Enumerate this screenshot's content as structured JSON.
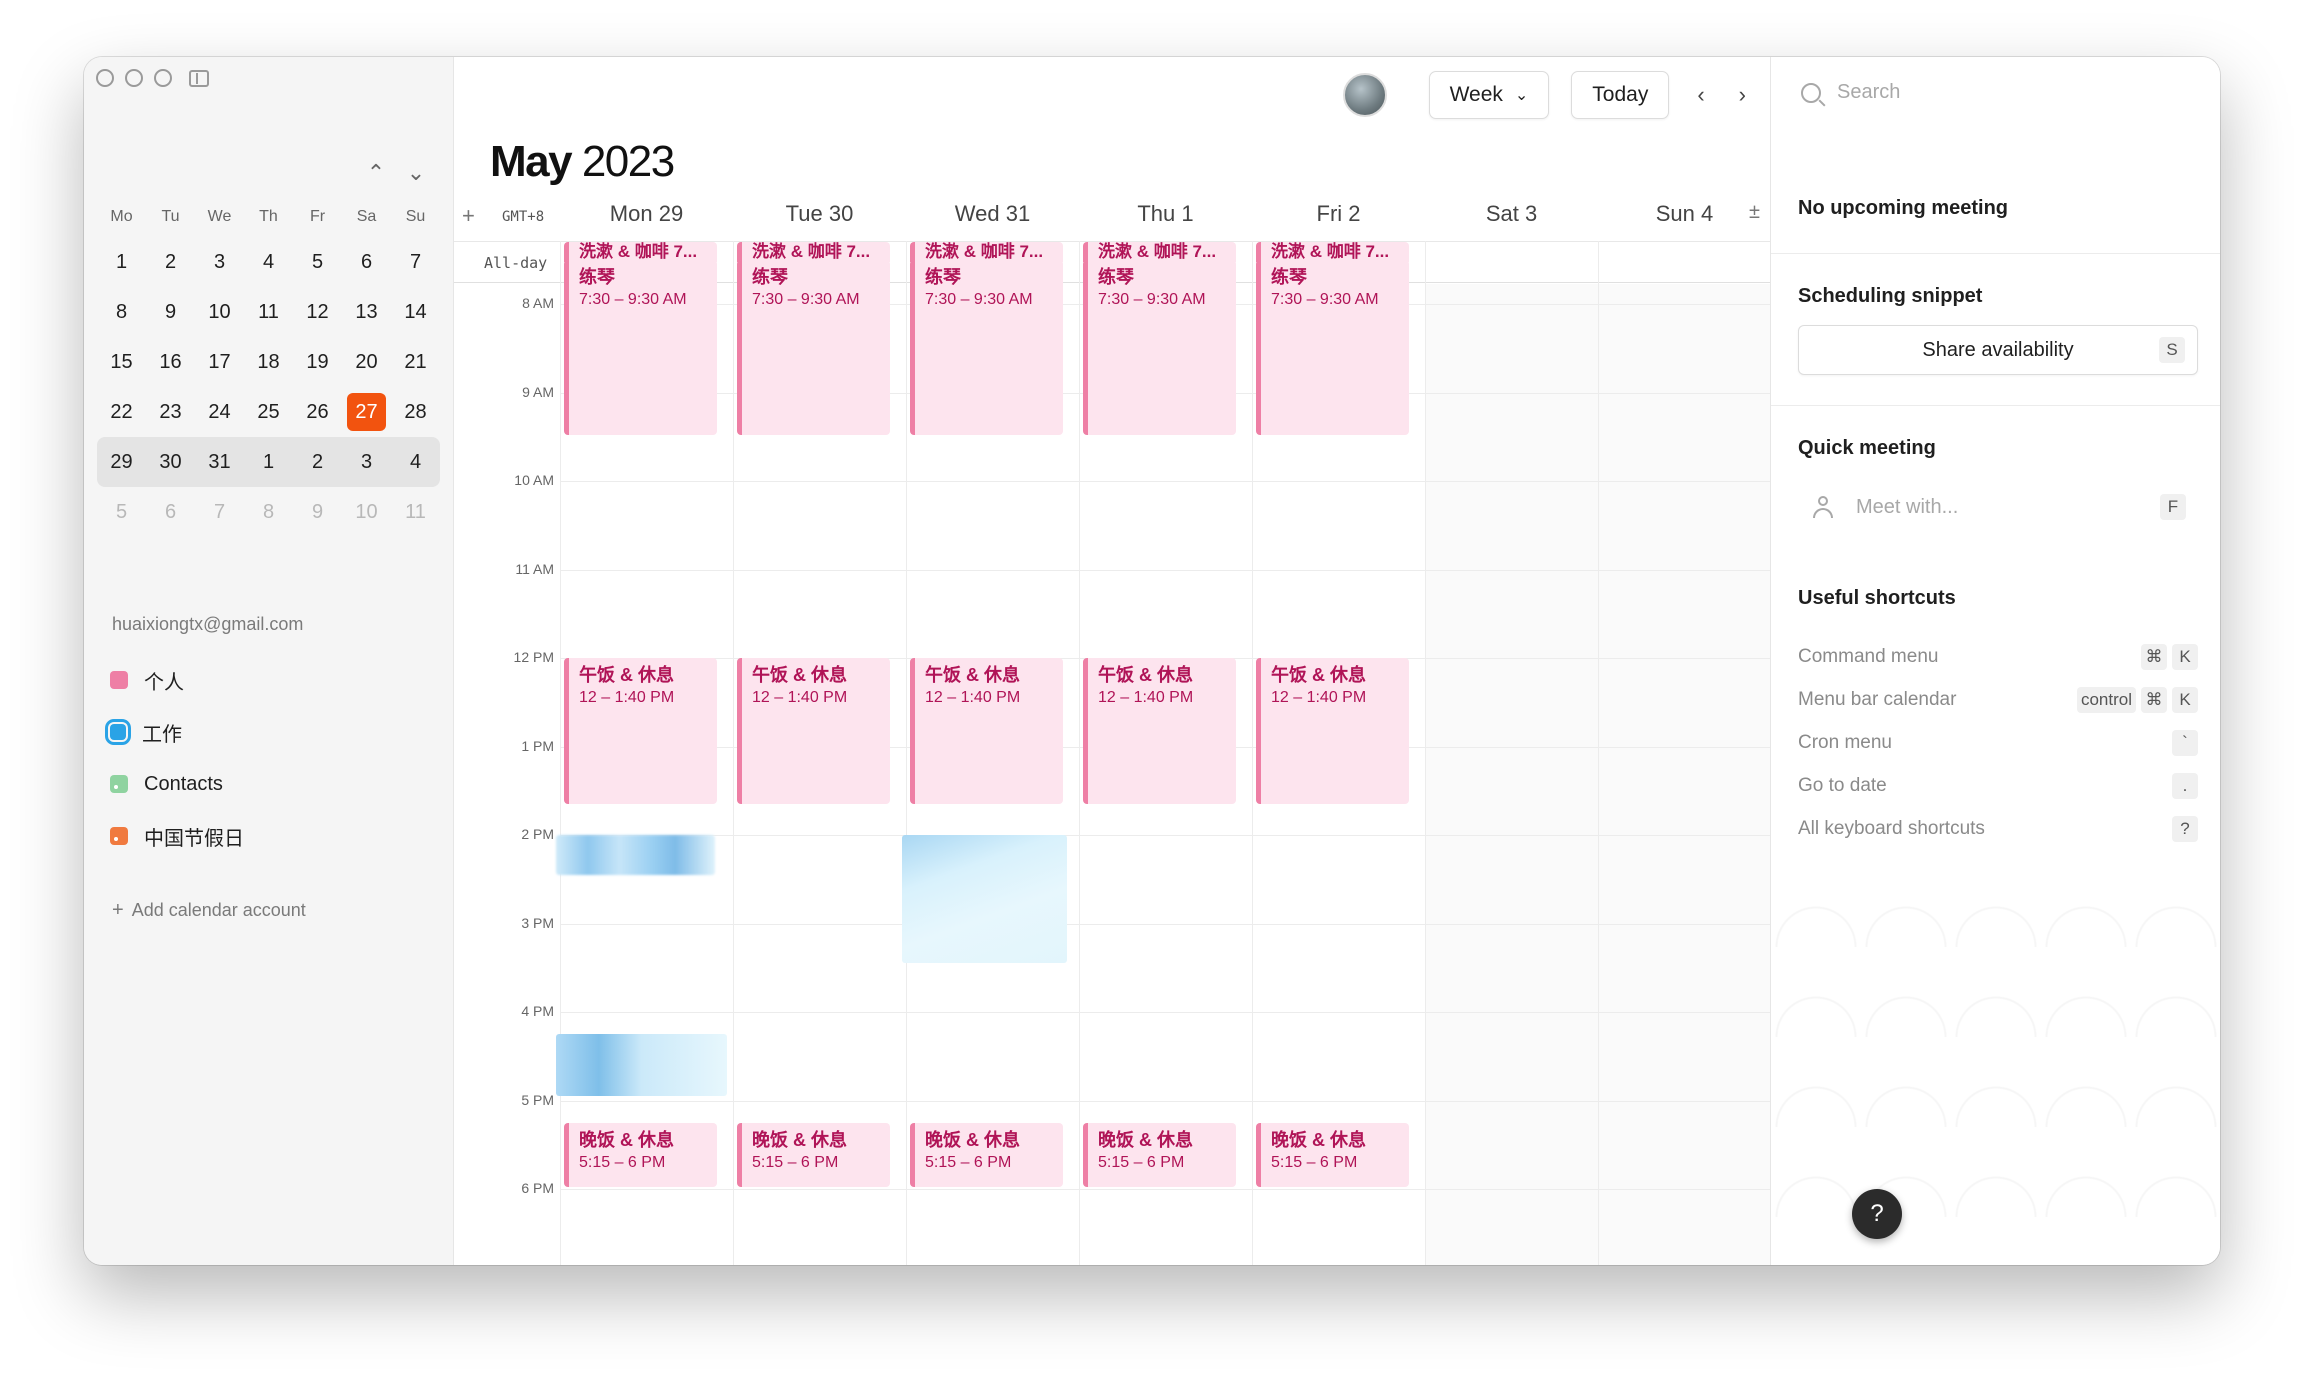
{
  "sidebar": {
    "mini_calendar": {
      "weekdays": [
        "Mo",
        "Tu",
        "We",
        "Th",
        "Fr",
        "Sa",
        "Su"
      ],
      "weeks": [
        [
          "1",
          "2",
          "3",
          "4",
          "5",
          "6",
          "7"
        ],
        [
          "8",
          "9",
          "10",
          "11",
          "12",
          "13",
          "14"
        ],
        [
          "15",
          "16",
          "17",
          "18",
          "19",
          "20",
          "21"
        ],
        [
          "22",
          "23",
          "24",
          "25",
          "26",
          "27",
          "28"
        ],
        [
          "29",
          "30",
          "31",
          "1",
          "2",
          "3",
          "4"
        ],
        [
          "5",
          "6",
          "7",
          "8",
          "9",
          "10",
          "11"
        ]
      ],
      "today": "27",
      "nav_up": "⌃",
      "nav_down": "⌄"
    },
    "account_email": "huaixiongtx@gmail.com",
    "calendars": [
      {
        "name": "个人",
        "color": "#ee7fa5"
      },
      {
        "name": "工作",
        "color": "#2aa3e6"
      },
      {
        "name": "Contacts",
        "color": "#8fd3a0"
      },
      {
        "name": "中国节假日",
        "color": "#f07a3f"
      }
    ],
    "add_account_label": "Add calendar account"
  },
  "toolbar": {
    "view_label": "Week",
    "today_label": "Today",
    "prev": "‹",
    "next": "›"
  },
  "header": {
    "month": "May",
    "year": "2023"
  },
  "week": {
    "timezone": "GMT+8",
    "allday_label": "All-day",
    "days": [
      "Mon 29",
      "Tue 30",
      "Wed 31",
      "Thu 1",
      "Fri 2",
      "Sat 3",
      "Sun 4"
    ],
    "hours": [
      "8 AM",
      "9 AM",
      "10 AM",
      "11 AM",
      "12 PM",
      "1 PM",
      "2 PM",
      "3 PM",
      "4 PM",
      "5 PM",
      "6 PM"
    ]
  },
  "events": {
    "wash_title": "洗漱 & 咖啡 7...",
    "piano_title": "练琴",
    "piano_time": "7:30 – 9:30 AM",
    "lunch_title": "午饭 & 休息",
    "lunch_time": "12 – 1:40 PM",
    "dinner_title": "晚饭 & 休息",
    "dinner_time": "5:15 – 6 PM"
  },
  "right_panel": {
    "search_placeholder": "Search",
    "no_meeting": "No upcoming meeting",
    "scheduling_title": "Scheduling snippet",
    "share_label": "Share availability",
    "share_key": "S",
    "quick_title": "Quick meeting",
    "meet_placeholder": "Meet with...",
    "meet_key": "F",
    "shortcuts_title": "Useful shortcuts",
    "shortcuts": [
      {
        "label": "Command menu",
        "keys": [
          "⌘",
          "K"
        ]
      },
      {
        "label": "Menu bar calendar",
        "keys": [
          "control",
          "⌘",
          "K"
        ]
      },
      {
        "label": "Cron menu",
        "keys": [
          "`"
        ]
      },
      {
        "label": "Go to date",
        "keys": [
          "."
        ]
      },
      {
        "label": "All keyboard shortcuts",
        "keys": [
          "?"
        ]
      }
    ]
  },
  "help_label": "?",
  "colors": {
    "today": "#f2530f",
    "event_bg": "#fde4ee",
    "event_text": "#b01457",
    "event_border": "#ee7fa5"
  }
}
